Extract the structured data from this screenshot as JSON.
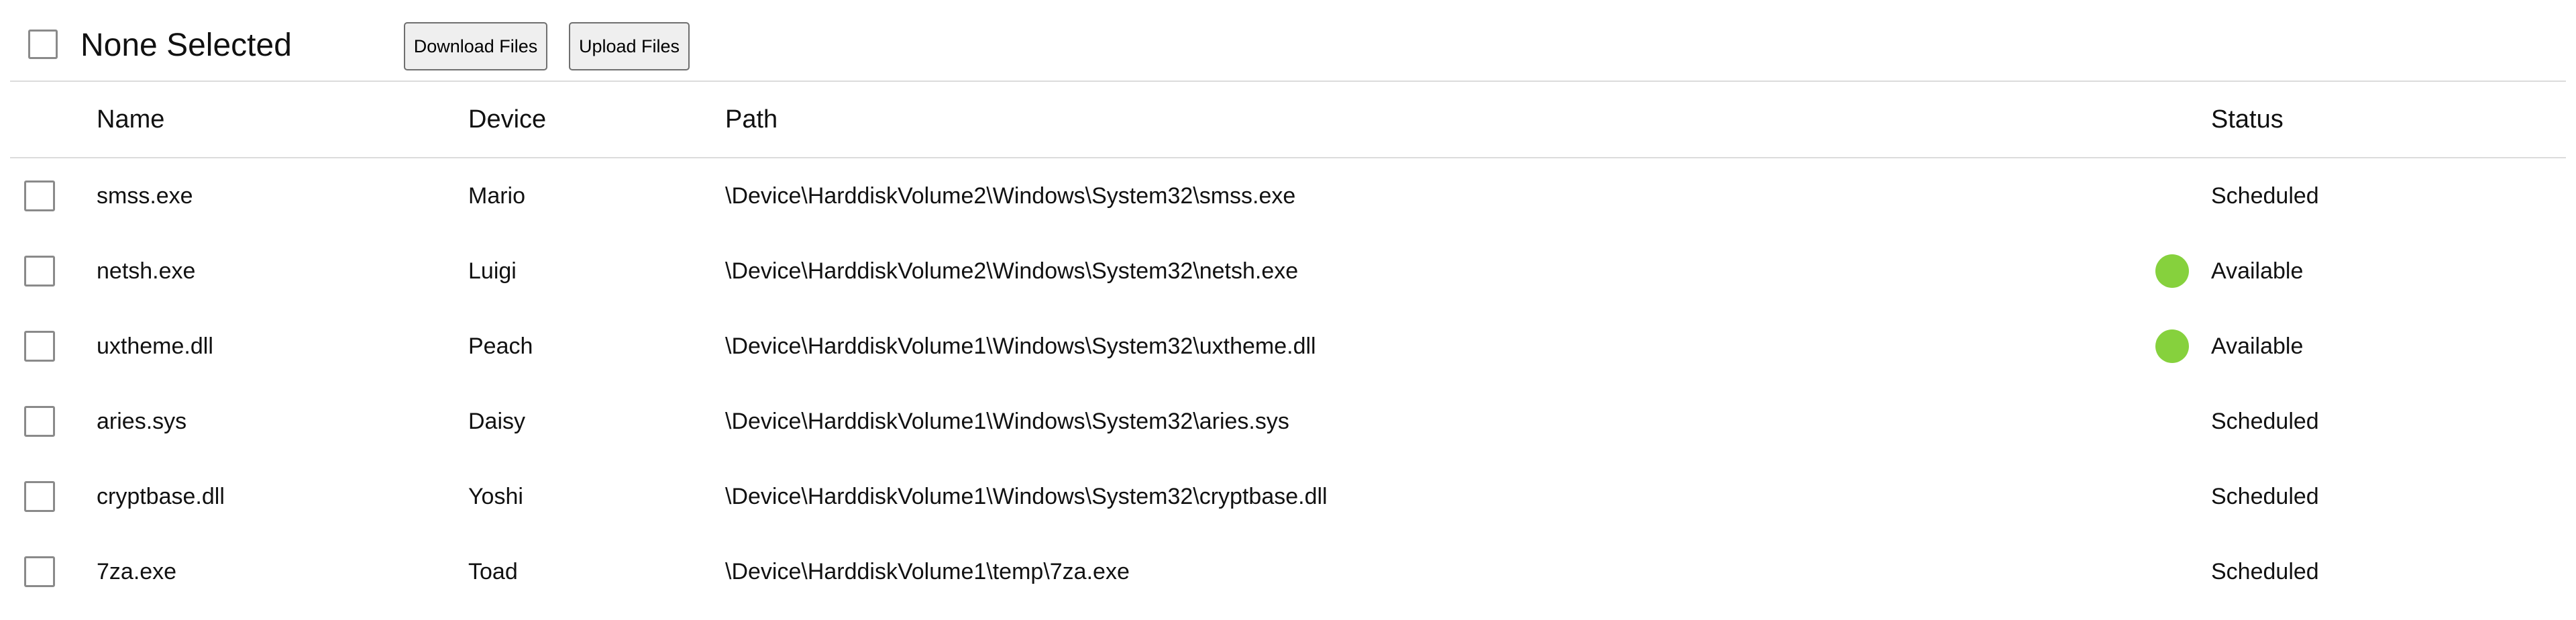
{
  "toolbar": {
    "selection_label": "None Selected",
    "download_label": "Download Files",
    "upload_label": "Upload Files"
  },
  "table": {
    "headers": {
      "name": "Name",
      "device": "Device",
      "path": "Path",
      "status": "Status"
    },
    "rows": [
      {
        "name": "smss.exe",
        "device": "Mario",
        "path": "\\Device\\HarddiskVolume2\\Windows\\System32\\smss.exe",
        "status": "Scheduled",
        "indicator": false
      },
      {
        "name": "netsh.exe",
        "device": "Luigi",
        "path": "\\Device\\HarddiskVolume2\\Windows\\System32\\netsh.exe",
        "status": "Available",
        "indicator": true
      },
      {
        "name": "uxtheme.dll",
        "device": "Peach",
        "path": "\\Device\\HarddiskVolume1\\Windows\\System32\\uxtheme.dll",
        "status": "Available",
        "indicator": true
      },
      {
        "name": "aries.sys",
        "device": "Daisy",
        "path": "\\Device\\HarddiskVolume1\\Windows\\System32\\aries.sys",
        "status": "Scheduled",
        "indicator": false
      },
      {
        "name": "cryptbase.dll",
        "device": "Yoshi",
        "path": "\\Device\\HarddiskVolume1\\Windows\\System32\\cryptbase.dll",
        "status": "Scheduled",
        "indicator": false
      },
      {
        "name": "7za.exe",
        "device": "Toad",
        "path": "\\Device\\HarddiskVolume1\\temp\\7za.exe",
        "status": "Scheduled",
        "indicator": false
      }
    ]
  },
  "colors": {
    "available_indicator": "#86d13d",
    "divider": "#dcdcdc",
    "button_bg": "#efefef"
  }
}
